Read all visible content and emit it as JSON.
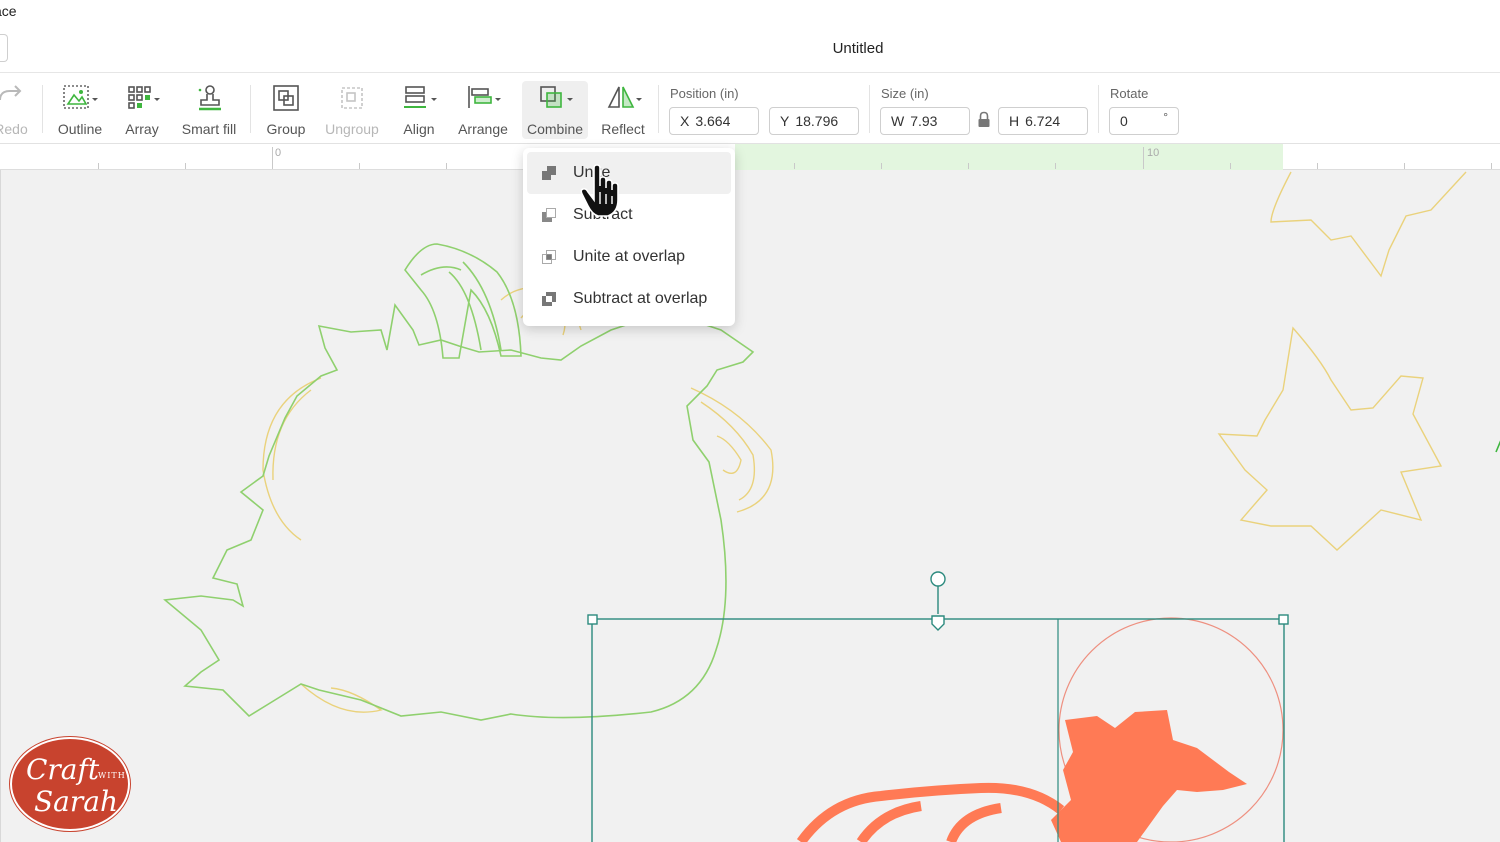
{
  "window": {
    "workspace_label": "ace",
    "title": "Untitled"
  },
  "toolbar": {
    "redo_label": "Redo",
    "outline_label": "Outline",
    "array_label": "Array",
    "smartfill_label": "Smart fill",
    "group_label": "Group",
    "ungroup_label": "Ungroup",
    "align_label": "Align",
    "arrange_label": "Arrange",
    "combine_label": "Combine",
    "reflect_label": "Reflect"
  },
  "position": {
    "label": "Position (in)",
    "x_prefix": "X",
    "x_value": "3.664",
    "y_prefix": "Y",
    "y_value": "18.796"
  },
  "size": {
    "label": "Size (in)",
    "w_prefix": "W",
    "w_value": "7.93",
    "h_prefix": "H",
    "h_value": "6.724"
  },
  "rotate": {
    "label": "Rotate",
    "value": "0",
    "unit": "°"
  },
  "ruler": {
    "mark_0": "0",
    "mark_10": "10"
  },
  "combine_menu": {
    "items": [
      {
        "label": "Unite"
      },
      {
        "label": "Subtract"
      },
      {
        "label": "Unite at overlap"
      },
      {
        "label": "Subtract at overlap"
      }
    ]
  },
  "logo": {
    "line1": "Craft",
    "with": "WITH",
    "line2": "Sarah"
  },
  "colors": {
    "accent_green": "#3fb63f",
    "outline_green": "#8fd06e",
    "outline_yellow": "#ead27c",
    "selection_teal": "#2c8a7e",
    "shape_orange": "#ff7a55"
  }
}
